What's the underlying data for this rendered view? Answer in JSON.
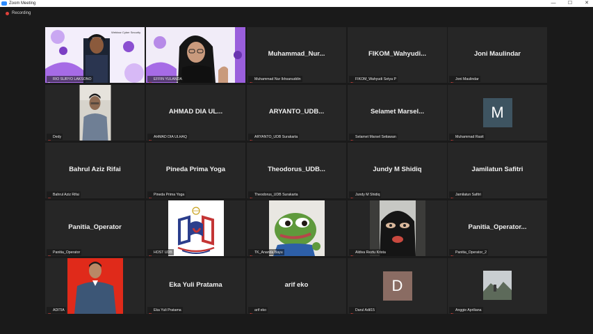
{
  "window": {
    "title": "Zoom Meeting",
    "controls": [
      "—",
      "☐",
      "✕"
    ]
  },
  "recording": {
    "label": "Recording"
  },
  "colors": {
    "active_outline": "#c8d83a",
    "tile_bg": "#262626",
    "mic_muted": "#e0403a"
  },
  "tiles": [
    {
      "label": "RIO SURYO LAKSONO",
      "big": "",
      "kind": "video-webinar",
      "mic": "on"
    },
    {
      "label": "EFFIN YULANDA",
      "big": "",
      "kind": "video-webinar2",
      "mic": "muted"
    },
    {
      "label": "Muhammad Nur Ikhsanuddin",
      "big": "Muhammad_Nur...",
      "kind": "name",
      "mic": "muted"
    },
    {
      "label": "FIKOM_Wahyudi Setya P",
      "big": "FIKOM_Wahyudi...",
      "kind": "name",
      "mic": "muted"
    },
    {
      "label": "Joni Maulindar",
      "big": "Joni Maulindar",
      "kind": "name",
      "mic": "muted"
    },
    {
      "label": "Dedy",
      "big": "",
      "kind": "video-person",
      "mic": "muted"
    },
    {
      "label": "AHMAD DIA ULHAQ",
      "big": "AHMAD DIA UL...",
      "kind": "name",
      "mic": "muted"
    },
    {
      "label": "ARYANTO_UDB Surakarta",
      "big": "ARYANTO_UDB...",
      "kind": "name",
      "mic": "muted"
    },
    {
      "label": "Selamet Marsel Setiawan",
      "big": "Selamet Marsel...",
      "kind": "name",
      "mic": "muted"
    },
    {
      "label": "Muhammad Rasit",
      "big": "M",
      "kind": "avatar",
      "avatar_color": "#3e5461",
      "mic": "muted"
    },
    {
      "label": "Bahrul Aziz Rifai",
      "big": "Bahrul Aziz Rifai",
      "kind": "name",
      "mic": "muted"
    },
    {
      "label": "Pineda Prima Yoga",
      "big": "Pineda Prima Yoga",
      "kind": "name",
      "mic": "muted"
    },
    {
      "label": "Theodorus_UDB Surakarta",
      "big": "Theodorus_UDB...",
      "kind": "name",
      "mic": "muted"
    },
    {
      "label": "Jundy M Shidiq",
      "big": "Jundy M Shidiq",
      "kind": "name",
      "mic": "muted"
    },
    {
      "label": "Jamilatun Safitri",
      "big": "Jamilatun Safitri",
      "kind": "name",
      "mic": "muted"
    },
    {
      "label": "Panitia_Operator",
      "big": "Panitia_Operator",
      "kind": "name",
      "mic": "muted"
    },
    {
      "label": "HOST UDB",
      "big": "",
      "kind": "logo",
      "mic": "muted"
    },
    {
      "label": "TK_Ananda Bayu",
      "big": "",
      "kind": "frog",
      "mic": "muted"
    },
    {
      "label": "Aldiva Reztu Krista",
      "big": "",
      "kind": "mask",
      "mic": "muted"
    },
    {
      "label": "Panitia_Operator_2",
      "big": "Panitia_Operator...",
      "kind": "name",
      "mic": "muted"
    },
    {
      "label": "ADITIA",
      "big": "",
      "kind": "video-red",
      "mic": "muted"
    },
    {
      "label": "Eka Yuli Pratama",
      "big": "Eka Yuli Pratama",
      "kind": "name",
      "mic": "muted"
    },
    {
      "label": "arif eko",
      "big": "arif eko",
      "kind": "name",
      "mic": "muted"
    },
    {
      "label": "Darul Adil15",
      "big": "D",
      "kind": "avatar",
      "avatar_color": "#8a6c63",
      "mic": "muted"
    },
    {
      "label": "Anggie Apriliana",
      "big": "",
      "kind": "landscape",
      "mic": "muted"
    }
  ]
}
